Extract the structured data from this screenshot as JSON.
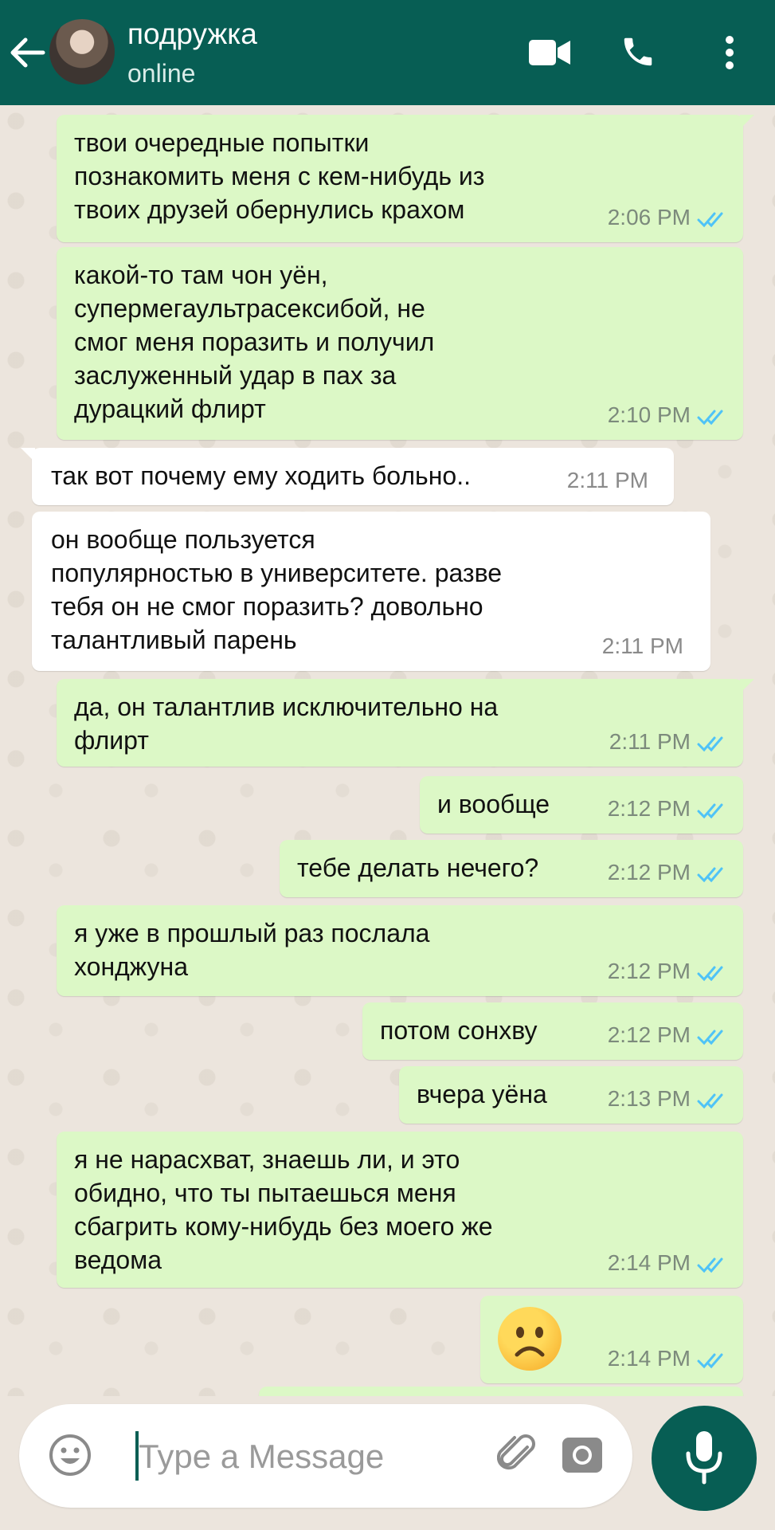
{
  "header": {
    "contact_name": "подружка",
    "status": "online"
  },
  "composer": {
    "placeholder": "Type a Message"
  },
  "colors": {
    "header": "#075E54",
    "outgoing_bubble": "#DCF8C6",
    "incoming_bubble": "#FFFFFF",
    "read_ticks": "#4FC3F7",
    "chat_background": "#ECE5DD"
  },
  "icons": {
    "back": "back-arrow-icon",
    "video": "video-call-icon",
    "call": "phone-icon",
    "menu": "more-vert-icon",
    "emoji": "emoji-icon",
    "attach": "paperclip-icon",
    "camera": "camera-icon",
    "mic": "microphone-icon"
  },
  "messages": [
    {
      "direction": "out",
      "text": "твои очередные попытки\nпознакомить меня с кем-нибудь из\nтвоих друзей обернулись крахом",
      "time": "2:06 PM",
      "read": true
    },
    {
      "direction": "out",
      "text": "какой-то там чон уён,\nсупермегаультрасексибой, не\nсмог меня поразить и получил\nзаслуженный удар в пах за\nдурацкий флирт",
      "time": "2:10 PM",
      "read": true
    },
    {
      "direction": "in",
      "text": "так вот почему ему ходить больно..",
      "time": "2:11 PM"
    },
    {
      "direction": "in",
      "text": "он вообще пользуется\nпопулярностью в университете. разве\nтебя он не смог поразить? довольно\nталантливый парень",
      "time": "2:11 PM"
    },
    {
      "direction": "out",
      "text": "да, он талантлив исключительно на\nфлирт",
      "time": "2:11 PM",
      "read": true
    },
    {
      "direction": "out",
      "text": "и вообще",
      "time": "2:12 PM",
      "read": true
    },
    {
      "direction": "out",
      "text": "тебе делать нечего?",
      "time": "2:12 PM",
      "read": true
    },
    {
      "direction": "out",
      "text": "я уже в прошлый раз послала\nхонджуна",
      "time": "2:12 PM",
      "read": true
    },
    {
      "direction": "out",
      "text": "потом сонхву",
      "time": "2:12 PM",
      "read": true
    },
    {
      "direction": "out",
      "text": "вчера уёна",
      "time": "2:13 PM",
      "read": true
    },
    {
      "direction": "out",
      "text": "я не нарасхват, знаешь ли, и это\nобидно, что ты пытаешься меня\nсбагрить кому-нибудь без моего же\nведома",
      "time": "2:14 PM",
      "read": true
    },
    {
      "direction": "out",
      "emoji": "frowning-face-emoji",
      "time": "2:14 PM",
      "read": true
    }
  ]
}
